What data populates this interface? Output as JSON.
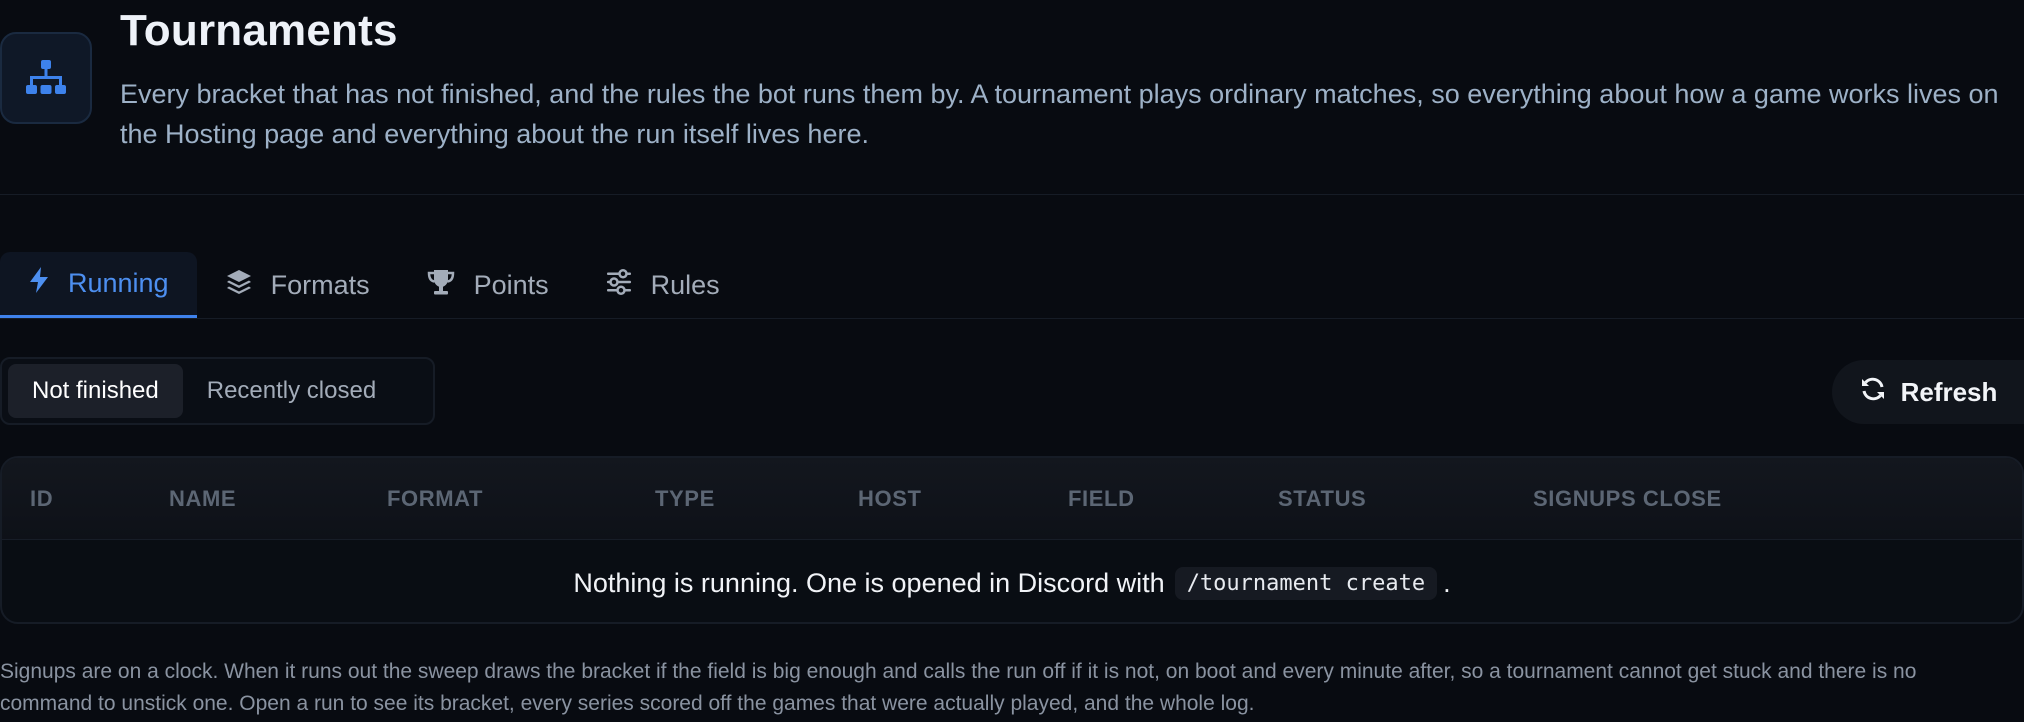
{
  "header": {
    "icon": "sitemap-icon",
    "title": "Tournaments",
    "description": "Every bracket that has not finished, and the rules the bot runs them by. A tournament plays ordinary matches, so everything about how a game works lives on the Hosting page and everything about the run itself lives here."
  },
  "tabs": [
    {
      "label": "Running",
      "icon": "bolt-icon",
      "active": true
    },
    {
      "label": "Formats",
      "icon": "layers-icon",
      "active": false
    },
    {
      "label": "Points",
      "icon": "trophy-icon",
      "active": false
    },
    {
      "label": "Rules",
      "icon": "sliders-icon",
      "active": false
    }
  ],
  "filter": {
    "options": [
      "Not finished",
      "Recently closed"
    ],
    "selected": "Not finished"
  },
  "refresh": {
    "label": "Refresh",
    "icon": "refresh-icon"
  },
  "table": {
    "columns": [
      "ID",
      "NAME",
      "FORMAT",
      "TYPE",
      "HOST",
      "FIELD",
      "STATUS",
      "SIGNUPS CLOSE"
    ],
    "empty": {
      "before": "Nothing is running. One is opened in Discord with",
      "command": "/tournament create",
      "after": "."
    }
  },
  "footnote": "Signups are on a clock. When it runs out the sweep draws the bracket if the field is big enough and calls the run off if it is not, on boot and every minute after, so a tournament cannot get stuck and there is no command to unstick one. Open a run to see its bracket, every series scored off the games that were actually played, and the whole log.",
  "colors": {
    "background": "#080b11",
    "accent": "#3f82ec",
    "muted_text": "#a3acb9"
  }
}
